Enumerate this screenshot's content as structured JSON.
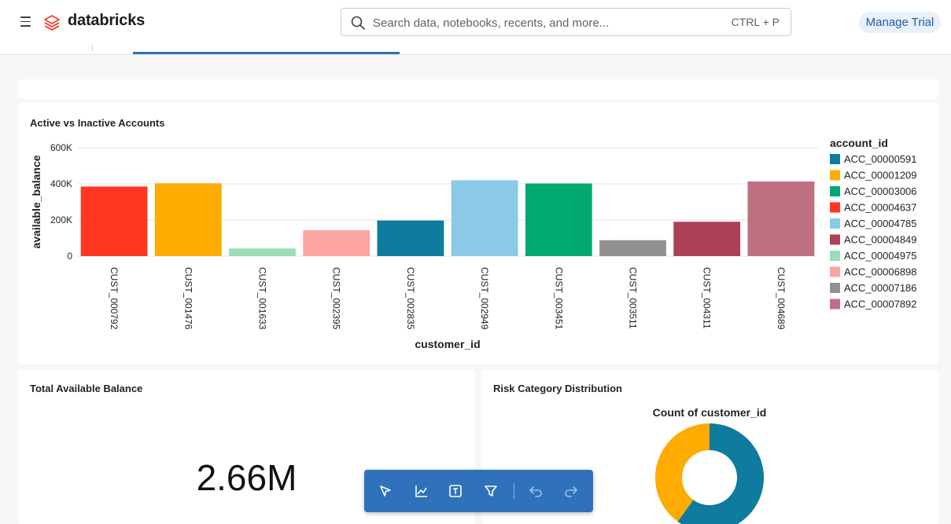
{
  "app": {
    "brand": "databricks",
    "search": {
      "placeholder": "Search data, notebooks, recents, and more...",
      "shortcut": "CTRL + P"
    },
    "trial_label": "Manage Trial"
  },
  "widgets": {
    "bar_title": "Active vs Inactive Accounts",
    "kpi_title": "Total Available Balance",
    "kpi_value": "2.66M",
    "donut_title": "Risk Category Distribution"
  },
  "toolbar": {
    "tools": [
      "select-pointer-icon",
      "line-chart-icon",
      "text-box-icon",
      "filter-icon",
      "undo-icon",
      "redo-icon"
    ]
  },
  "chart_data": [
    {
      "type": "bar",
      "title": "",
      "xlabel": "customer_id",
      "ylabel": "available_balance",
      "ylim": [
        0,
        600000
      ],
      "yticks": [
        "0",
        "200K",
        "400K",
        "600K"
      ],
      "grid": true,
      "legend": {
        "title": "account_id",
        "position": "right"
      },
      "categories": [
        "CUST_000792",
        "CUST_001476",
        "CUST_001633",
        "CUST_002395",
        "CUST_002835",
        "CUST_002949",
        "CUST_003451",
        "CUST_003511",
        "CUST_004311",
        "CUST_004689"
      ],
      "values": [
        385000,
        403000,
        42000,
        143000,
        197000,
        420000,
        402000,
        88000,
        190000,
        413000
      ],
      "bar_series": [
        "ACC_00004637",
        "ACC_00001209",
        "ACC_00004975",
        "ACC_00006898",
        "ACC_00000591",
        "ACC_00004785",
        "ACC_00003006",
        "ACC_00007186",
        "ACC_00004849",
        "ACC_00007892"
      ],
      "series": [
        {
          "name": "ACC_00000591",
          "color": "#0f7b9e"
        },
        {
          "name": "ACC_00001209",
          "color": "#ffab00"
        },
        {
          "name": "ACC_00003006",
          "color": "#00a972"
        },
        {
          "name": "ACC_00004637",
          "color": "#ff3621"
        },
        {
          "name": "ACC_00004785",
          "color": "#8bcae7"
        },
        {
          "name": "ACC_00004849",
          "color": "#ab4057"
        },
        {
          "name": "ACC_00004975",
          "color": "#99dcb5"
        },
        {
          "name": "ACC_00006898",
          "color": "#fca4a1"
        },
        {
          "name": "ACC_00007186",
          "color": "#919191"
        },
        {
          "name": "ACC_00007892",
          "color": "#bf7080"
        }
      ]
    },
    {
      "type": "pie",
      "title": "Count of customer_id",
      "slices": [
        {
          "value": 0.6,
          "color": "#0f7b9e"
        },
        {
          "value": 0.4,
          "color": "#ffab00"
        }
      ]
    }
  ]
}
